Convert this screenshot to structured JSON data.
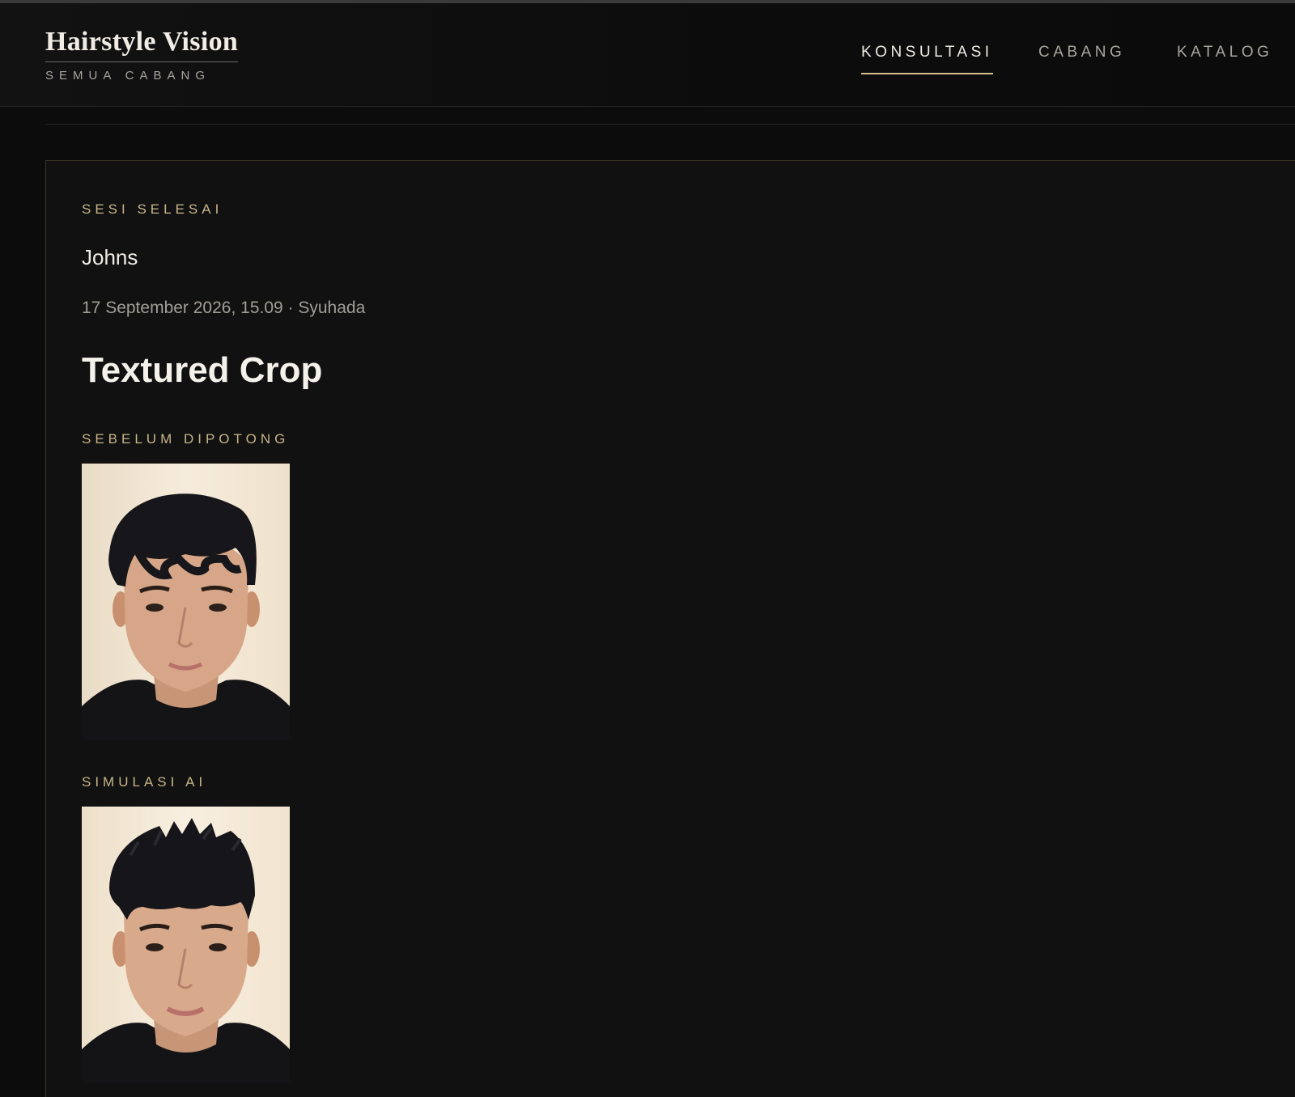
{
  "header": {
    "brand_title": "Hairstyle Vision",
    "brand_subtitle": "SEMUA CABANG",
    "nav": [
      {
        "label": "KONSULTASI",
        "active": true
      },
      {
        "label": "CABANG",
        "active": false
      },
      {
        "label": "KATALOG",
        "active": false
      }
    ]
  },
  "session": {
    "status_label": "SESI SELESAI",
    "customer_name": "Johns",
    "meta": "17 September 2026, 15.09 · Syuhada",
    "style_name": "Textured Crop",
    "before_label": "SEBELUM DIPOTONG",
    "simulation_label": "SIMULASI AI"
  },
  "colors": {
    "accent_gold": "#c8b68a",
    "active_underline": "#d6c290",
    "background": "#0c0c0c",
    "card": "#111111"
  }
}
